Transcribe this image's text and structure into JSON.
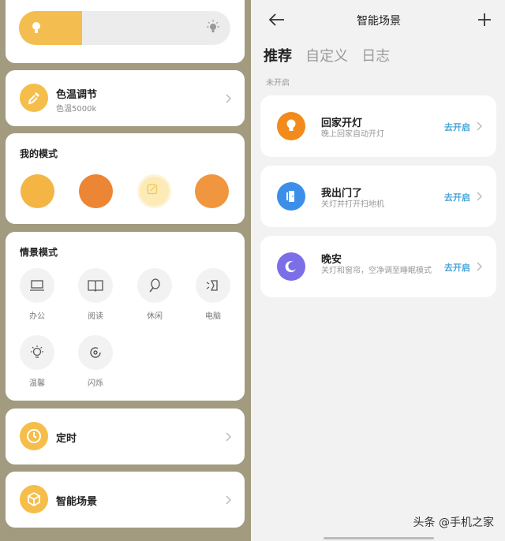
{
  "left": {
    "brightness": {
      "level": 0.3
    },
    "color_temp": {
      "title": "色温调节",
      "subtitle": "色温5000k"
    },
    "my_modes": {
      "title": "我的模式",
      "colors": [
        "#f4b544",
        "#ec8534",
        "#fcebb6",
        "#ef963e"
      ]
    },
    "scene_modes": {
      "title": "情景模式",
      "items": [
        {
          "label": "办公",
          "icon": "laptop-icon"
        },
        {
          "label": "阅读",
          "icon": "book-icon"
        },
        {
          "label": "休闲",
          "icon": "tennis-racket-icon"
        },
        {
          "label": "电脑",
          "icon": "monitor-light-icon"
        },
        {
          "label": "温馨",
          "icon": "bulb-icon"
        },
        {
          "label": "闪烁",
          "icon": "flash-icon"
        }
      ]
    },
    "timer": {
      "title": "定时"
    },
    "smart_scene": {
      "title": "智能场景"
    }
  },
  "right": {
    "title": "智能场景",
    "tabs": [
      {
        "label": "推荐",
        "active": true
      },
      {
        "label": "自定义",
        "active": false
      },
      {
        "label": "日志",
        "active": false
      }
    ],
    "status_label": "未开启",
    "scenes": [
      {
        "title": "回家开灯",
        "desc": "晚上回家自动开灯",
        "action": "去开启",
        "color": "#f28a1c",
        "icon": "bulb-icon"
      },
      {
        "title": "我出门了",
        "desc": "关灯并打开扫地机",
        "action": "去开启",
        "color": "#3c8ee8",
        "icon": "door-icon"
      },
      {
        "title": "晚安",
        "desc": "关灯和窗帘，空净调至睡眠模式",
        "action": "去开启",
        "color": "#7b6ee6",
        "icon": "moon-icon"
      }
    ]
  },
  "watermark": "头条 @手机之家",
  "colors": {
    "accent": "#f4bd50",
    "link": "#47a6d8"
  }
}
